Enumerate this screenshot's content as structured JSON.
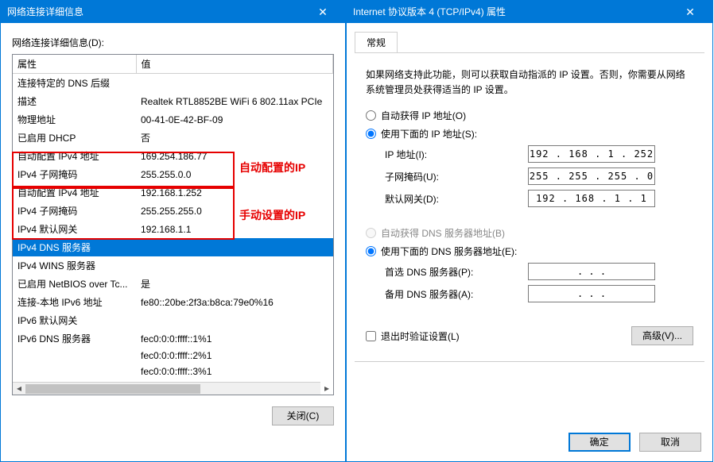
{
  "win1": {
    "title": "网络连接详细信息",
    "label": "网络连接详细信息(D):",
    "col_prop": "属性",
    "col_val": "值",
    "rows": [
      {
        "p": "连接特定的 DNS 后缀",
        "v": ""
      },
      {
        "p": "描述",
        "v": "Realtek RTL8852BE WiFi 6 802.11ax PCIe"
      },
      {
        "p": "物理地址",
        "v": "00-41-0E-42-BF-09"
      },
      {
        "p": "已启用 DHCP",
        "v": "否"
      },
      {
        "p": "自动配置 IPv4 地址",
        "v": "169.254.186.77"
      },
      {
        "p": "IPv4 子网掩码",
        "v": "255.255.0.0"
      },
      {
        "p": "自动配置 IPv4 地址",
        "v": "192.168.1.252"
      },
      {
        "p": "IPv4 子网掩码",
        "v": "255.255.255.0"
      },
      {
        "p": "IPv4 默认网关",
        "v": "192.168.1.1"
      },
      {
        "p": "IPv4 DNS 服务器",
        "v": "",
        "sel": true
      },
      {
        "p": "IPv4 WINS 服务器",
        "v": ""
      },
      {
        "p": "已启用 NetBIOS over Tc...",
        "v": "是"
      },
      {
        "p": "连接-本地 IPv6 地址",
        "v": "fe80::20be:2f3a:b8ca:79e0%16"
      },
      {
        "p": "IPv6 默认网关",
        "v": ""
      },
      {
        "p": "IPv6 DNS 服务器",
        "v": "fec0:0:0:ffff::1%1"
      },
      {
        "p": "",
        "v": "fec0:0:0:ffff::2%1"
      },
      {
        "p": "",
        "v": "fec0:0:0:ffff::3%1"
      }
    ],
    "close_btn": "关闭(C)",
    "annot1": "自动配置的IP",
    "annot2": "手动设置的IP"
  },
  "win2": {
    "title": "Internet 协议版本 4 (TCP/IPv4) 属性",
    "tab": "常规",
    "desc": "如果网络支持此功能，则可以获取自动指派的 IP 设置。否则，你需要从网络系统管理员处获得适当的 IP 设置。",
    "r_auto_ip": "自动获得 IP 地址(O)",
    "r_use_ip": "使用下面的 IP 地址(S):",
    "f_ip": "IP 地址(I):",
    "f_mask": "子网掩码(U):",
    "f_gw": "默认网关(D):",
    "v_ip": "192 . 168 .   1  . 252",
    "v_mask": "255 . 255 . 255 .   0",
    "v_gw": "192 . 168 .   1  .   1",
    "r_auto_dns": "自动获得 DNS 服务器地址(B)",
    "r_use_dns": "使用下面的 DNS 服务器地址(E):",
    "f_dns1": "首选 DNS 服务器(P):",
    "f_dns2": "备用 DNS 服务器(A):",
    "v_dns_empty": ".         .         .",
    "chk_validate": "退出时验证设置(L)",
    "btn_adv": "高级(V)...",
    "btn_ok": "确定",
    "btn_cancel": "取消"
  }
}
